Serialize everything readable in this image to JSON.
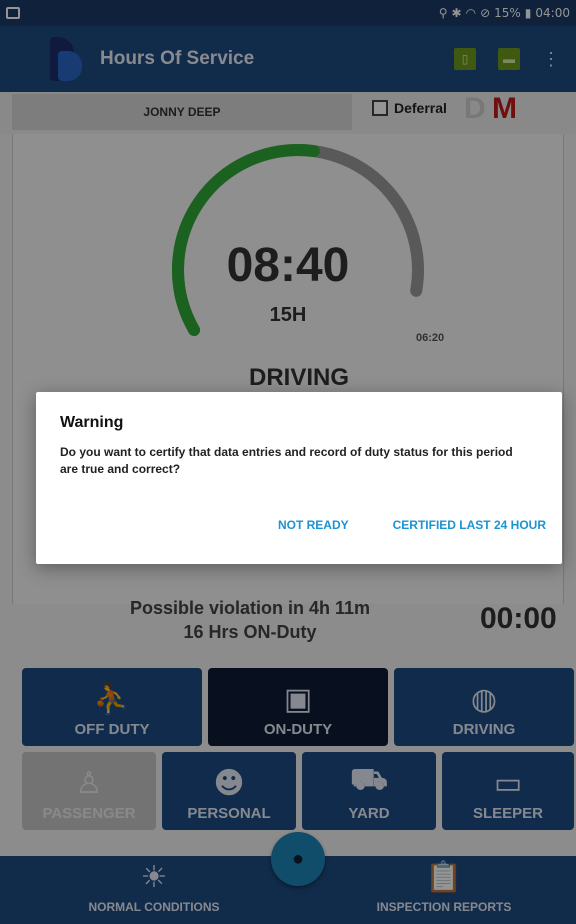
{
  "status_bar": {
    "time": "04:00",
    "battery": "15%"
  },
  "app": {
    "title": "Hours Of Service"
  },
  "driver": {
    "name": "JONNY DEEP",
    "deferral_label": "Deferral",
    "deferral_checked": false,
    "letter_d": "D",
    "letter_m": "M"
  },
  "gauge": {
    "time": "08:40",
    "hours": "15H",
    "remaining": "06:20",
    "status": "DRIVING",
    "elapsed_fraction": 0.58,
    "color_elapsed": "#2faa3a",
    "color_remaining": "#9a9a9a"
  },
  "violation": {
    "line1": "Possible violation in 4h 11m",
    "line2": "16 Hrs ON-Duty",
    "timer": "00:00"
  },
  "duty_buttons": [
    {
      "label": "OFF DUTY",
      "icon": "recline-icon",
      "state": "normal"
    },
    {
      "label": "ON-DUTY",
      "icon": "clipboard-icon",
      "state": "active"
    },
    {
      "label": "DRIVING",
      "icon": "steering-wheel-icon",
      "state": "normal"
    },
    {
      "label": "PASSENGER",
      "icon": "seat-icon",
      "state": "disabled"
    },
    {
      "label": "PERSONAL",
      "icon": "person-car-icon",
      "state": "normal"
    },
    {
      "label": "YARD",
      "icon": "yard-trucks-icon",
      "state": "normal"
    },
    {
      "label": "SLEEPER",
      "icon": "bed-icon",
      "state": "normal"
    }
  ],
  "bottom_nav": {
    "left_label": "NORMAL CONDITIONS",
    "right_label": "INSPECTION REPORTS"
  },
  "dialog": {
    "title": "Warning",
    "message": "Do you want to certify that data entries and record of duty status for this period are true and correct?",
    "not_ready": "NOT READY",
    "certified": "CERTIFIED LAST 24 HOUR"
  },
  "colors": {
    "primary": "#1e4b80",
    "accent": "#1b94d2",
    "active": "#0f1c36",
    "danger": "#c21a1a"
  }
}
